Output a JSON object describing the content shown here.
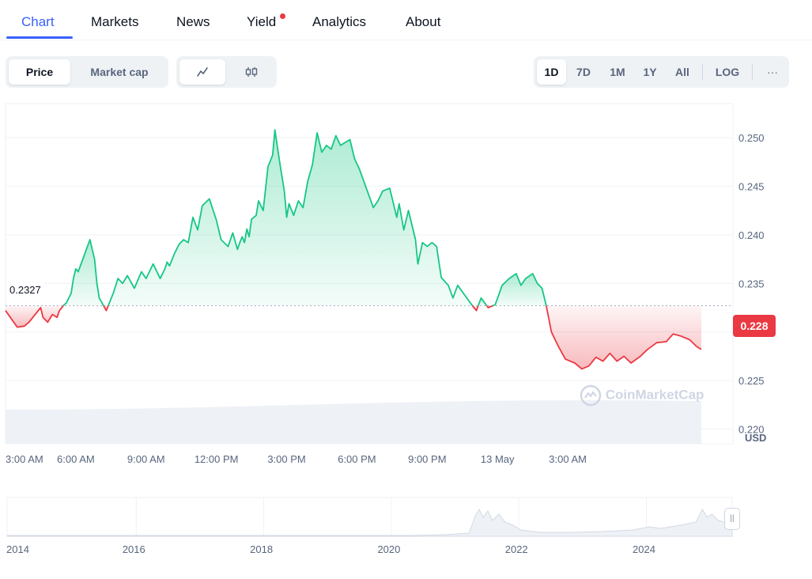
{
  "tabs": {
    "items": [
      {
        "label": "Chart",
        "active": true
      },
      {
        "label": "Markets"
      },
      {
        "label": "News"
      },
      {
        "label": "Yield",
        "has_dot": true
      },
      {
        "label": "Analytics"
      },
      {
        "label": "About"
      }
    ]
  },
  "toolbar": {
    "view_toggle": [
      "Price",
      "Market cap"
    ],
    "view_selected": "Price",
    "chart_type_icons": [
      "line-chart-icon",
      "candlestick-icon"
    ],
    "chart_type_selected": "line-chart-icon",
    "ranges": [
      "1D",
      "7D",
      "1M",
      "1Y",
      "All"
    ],
    "range_selected": "1D",
    "log_label": "LOG",
    "more_label": "···"
  },
  "chart": {
    "reference_price": "0.2327",
    "current_price": "0.228",
    "watermark": "CoinMarketCap",
    "currency": "USD",
    "colors": {
      "up": "#16c784",
      "down": "#ea3943",
      "accent": "#3861fb"
    }
  },
  "chart_data": {
    "type": "line",
    "y_tick_labels": [
      "0.250",
      "0.245",
      "0.240",
      "0.235",
      "0.230",
      "0.225",
      "0.220"
    ],
    "ylim": [
      0.2185,
      0.2535
    ],
    "baseline": 0.2327,
    "x_tick_labels": [
      "3:00 AM",
      "6:00 AM",
      "9:00 AM",
      "12:00 PM",
      "3:00 PM",
      "6:00 PM",
      "9:00 PM",
      "13 May",
      "3:00 AM"
    ],
    "x_hours": [
      0,
      3,
      6,
      9,
      12,
      15,
      18,
      21,
      24
    ],
    "series": [
      {
        "x": [
          0,
          0.5,
          0.8,
          1.0,
          1.5,
          1.6,
          1.8,
          2.0,
          2.2,
          2.3,
          2.4,
          2.5,
          2.6,
          2.7,
          2.8,
          2.9,
          3.0,
          3.1,
          3.3,
          3.6,
          3.8,
          3.9,
          4.0,
          4.3,
          4.6,
          4.8,
          5.0,
          5.2,
          5.5,
          5.8,
          6.0,
          6.3,
          6.6,
          6.8,
          6.9,
          7.0,
          7.2,
          7.4,
          7.6,
          7.8,
          8.0,
          8.2,
          8.4,
          8.7,
          9.0,
          9.2,
          9.5,
          9.7,
          9.9,
          10.0,
          10.1,
          10.2,
          10.3,
          10.4,
          10.5,
          10.7,
          10.8,
          11.0,
          11.2,
          11.4,
          11.5,
          11.7,
          11.9,
          12.0,
          12.1,
          12.3,
          12.5,
          12.7,
          12.9,
          13.1,
          13.3,
          13.5,
          13.7,
          13.9,
          14.1,
          14.3,
          14.5,
          14.7,
          14.9,
          15.1,
          15.4,
          15.7,
          15.9,
          16.1,
          16.4,
          16.7,
          16.8,
          17.0,
          17.2,
          17.5,
          17.6,
          17.8,
          18.0,
          18.2,
          18.4,
          18.6,
          18.9,
          19.1,
          19.3,
          19.6,
          19.9,
          20.1,
          20.3,
          20.6,
          20.9,
          21.2,
          21.5,
          21.8,
          22.0,
          22.2,
          22.5,
          22.7,
          22.9,
          23.1,
          23.3,
          23.6,
          23.9,
          24.3,
          24.6,
          24.9,
          25.2,
          25.5,
          25.8,
          26.1,
          26.4,
          26.7,
          27.1,
          27.4,
          27.8,
          28.2,
          28.5,
          28.8,
          29.2,
          29.5,
          29.7
        ],
        "y": [
          0.2322,
          0.2305,
          0.2306,
          0.231,
          0.2325,
          0.2315,
          0.231,
          0.2318,
          0.2315,
          0.2322,
          0.2325,
          0.2328,
          0.233,
          0.2335,
          0.234,
          0.2355,
          0.2365,
          0.2362,
          0.2375,
          0.2395,
          0.2375,
          0.235,
          0.2335,
          0.2322,
          0.234,
          0.2355,
          0.235,
          0.2358,
          0.2345,
          0.2362,
          0.2355,
          0.237,
          0.2355,
          0.2365,
          0.2372,
          0.2368,
          0.238,
          0.239,
          0.2395,
          0.2392,
          0.2418,
          0.2405,
          0.243,
          0.2437,
          0.2415,
          0.2395,
          0.2388,
          0.2402,
          0.2385,
          0.2392,
          0.2398,
          0.2392,
          0.2406,
          0.2398,
          0.2416,
          0.242,
          0.2435,
          0.2425,
          0.247,
          0.2482,
          0.2508,
          0.2475,
          0.2445,
          0.2418,
          0.2432,
          0.242,
          0.2435,
          0.2428,
          0.2455,
          0.2472,
          0.2505,
          0.2485,
          0.2492,
          0.2488,
          0.2502,
          0.2492,
          0.2495,
          0.2498,
          0.2478,
          0.2468,
          0.2448,
          0.2428,
          0.2435,
          0.2445,
          0.2448,
          0.2418,
          0.2432,
          0.2405,
          0.2425,
          0.2395,
          0.237,
          0.2392,
          0.2388,
          0.2392,
          0.2388,
          0.2356,
          0.2348,
          0.2335,
          0.2348,
          0.2338,
          0.2328,
          0.2322,
          0.2335,
          0.2325,
          0.2328,
          0.2348,
          0.2355,
          0.236,
          0.2348,
          0.2355,
          0.236,
          0.235,
          0.2345,
          0.2325,
          0.23,
          0.2285,
          0.2272,
          0.2268,
          0.2262,
          0.2265,
          0.2274,
          0.227,
          0.2278,
          0.227,
          0.2275,
          0.2268,
          0.2275,
          0.2282,
          0.2289,
          0.229,
          0.2298,
          0.2296,
          0.2292,
          0.2285,
          0.2282
        ]
      }
    ],
    "volume_note": "light gray volume band along bottom"
  },
  "navigator": {
    "year_labels": [
      "2014",
      "2016",
      "2018",
      "2020",
      "2022",
      "2024"
    ],
    "handle_icon": "drag-handle-icon"
  }
}
